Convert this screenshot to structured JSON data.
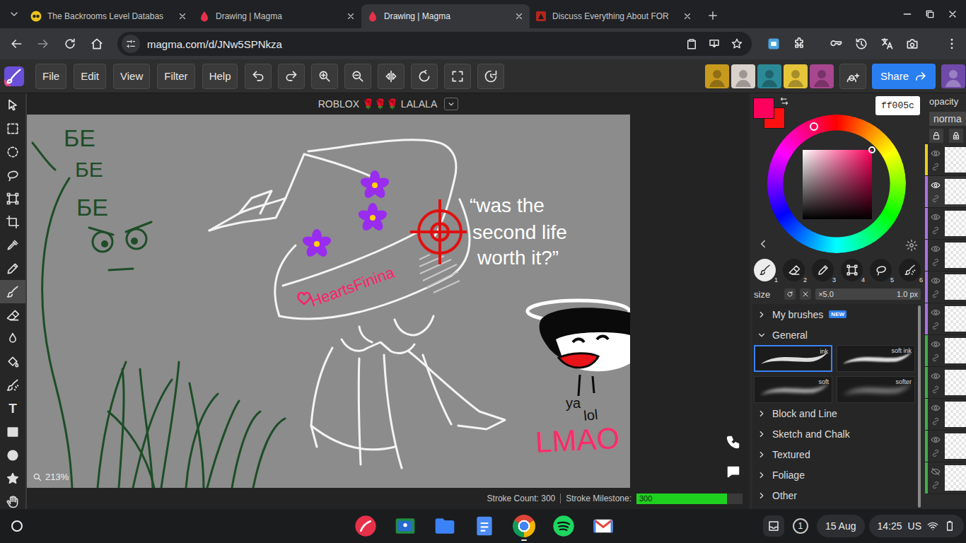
{
  "browser": {
    "tabs": [
      {
        "title": "The Backrooms Level Databas",
        "kind": "wiki",
        "selected": false
      },
      {
        "title": "Drawing | Magma",
        "kind": "magma",
        "selected": false
      },
      {
        "title": "Drawing | Magma",
        "kind": "magma",
        "selected": true
      },
      {
        "title": "Discuss Everything About FOR",
        "kind": "forum",
        "selected": false
      }
    ],
    "url": "magma.com/d/JNw5SPNkza"
  },
  "menu": [
    {
      "label": "File"
    },
    {
      "label": "Edit"
    },
    {
      "label": "View"
    },
    {
      "label": "Filter"
    },
    {
      "label": "Help"
    }
  ],
  "collaborators": [
    {
      "color": "#c79a1e"
    },
    {
      "color": "#d9d2cb"
    },
    {
      "color": "#2c8a96"
    },
    {
      "color": "#e6c53a"
    },
    {
      "color": "#a8478f"
    }
  ],
  "share": {
    "label": "Share"
  },
  "profile": {
    "color": "#6f4aa8"
  },
  "document": {
    "title": "ROBLOX 🌹🌹🌹 LALALA"
  },
  "tools": [
    {
      "kind": "move",
      "selected": false
    },
    {
      "kind": "marquee",
      "selected": false
    },
    {
      "kind": "oval",
      "selected": false
    },
    {
      "kind": "lasso",
      "selected": false
    },
    {
      "kind": "transform",
      "selected": false
    },
    {
      "kind": "crop",
      "selected": false
    },
    {
      "kind": "eyedropper",
      "selected": false
    },
    {
      "kind": "pencil",
      "selected": false
    },
    {
      "kind": "brush",
      "selected": true
    },
    {
      "kind": "eraser",
      "selected": false
    },
    {
      "kind": "smudge",
      "selected": false
    },
    {
      "kind": "fill",
      "selected": false
    },
    {
      "kind": "blend",
      "selected": false
    },
    {
      "kind": "text",
      "glyph": "T",
      "selected": false
    },
    {
      "kind": "rectangle",
      "selected": false
    },
    {
      "kind": "circle",
      "selected": false
    },
    {
      "kind": "shape",
      "selected": false
    },
    {
      "kind": "hand",
      "selected": false
    }
  ],
  "canvas": {
    "zoom": "213%",
    "texts": [
      {
        "text": "БЕ",
        "color": "#1d4d27"
      },
      {
        "text": "БЕ",
        "color": "#1d4d27"
      },
      {
        "text": "БЕ",
        "color": "#1d4d27"
      },
      {
        "text": "“was the",
        "color": "#ffffff"
      },
      {
        "text": "second life",
        "color": "#ffffff"
      },
      {
        "text": "worth it?”",
        "color": "#ffffff"
      },
      {
        "text": "HeartsFinina",
        "color": "#ff1f6b"
      },
      {
        "text": "ya",
        "color": "#111111"
      },
      {
        "text": "lol",
        "color": "#111111"
      },
      {
        "text": "LMAO",
        "color": "#ff2a6a"
      }
    ]
  },
  "status": {
    "stroke_count": "Stroke Count: 300",
    "milestone_label": "Stroke Milestone:",
    "milestone": "300",
    "level": 0.85
  },
  "color": {
    "hex": "ff005c",
    "primary": "#ff005c",
    "secondary": "#ff1010"
  },
  "brush_slots": [
    {
      "number": "1",
      "kind": "brush",
      "selected": true
    },
    {
      "number": "2",
      "kind": "eraser",
      "selected": false
    },
    {
      "number": "3",
      "kind": "pencil",
      "selected": false
    },
    {
      "number": "4",
      "kind": "transform",
      "selected": false
    },
    {
      "number": "5",
      "kind": "lasso",
      "selected": false
    },
    {
      "number": "6",
      "kind": "blend",
      "selected": false
    }
  ],
  "size": {
    "label": "size",
    "multiplier": "×5.0",
    "value": "1.0 px"
  },
  "brush_groups": [
    {
      "label": "My brushes",
      "badge": "NEW",
      "expanded": false,
      "presets": []
    },
    {
      "label": "General",
      "expanded": true,
      "presets": [
        {
          "name": "ink",
          "kind": "ink",
          "selected": true
        },
        {
          "name": "soft ink",
          "kind": "inksoft",
          "selected": false
        },
        {
          "name": "soft",
          "kind": "soft",
          "selected": false
        },
        {
          "name": "softer",
          "kind": "softer",
          "selected": false
        }
      ]
    },
    {
      "label": "Block and Line",
      "expanded": false,
      "presets": []
    },
    {
      "label": "Sketch and Chalk",
      "expanded": false,
      "presets": []
    },
    {
      "label": "Textured",
      "expanded": false,
      "presets": []
    },
    {
      "label": "Foliage",
      "expanded": false,
      "presets": []
    },
    {
      "label": "Other",
      "expanded": false,
      "presets": []
    }
  ],
  "layers": {
    "opacity_label": "opacity",
    "blend": "norma",
    "items": [
      {
        "color": "#e8cf1c",
        "visible": true,
        "selected": false
      },
      {
        "color": "#a873e6",
        "visible": true,
        "selected": true
      },
      {
        "color": "#a873e6",
        "visible": true,
        "selected": false
      },
      {
        "color": "#a873e6",
        "visible": true,
        "selected": false
      },
      {
        "color": "#a873e6",
        "visible": true,
        "selected": false
      },
      {
        "color": "#a873e6",
        "visible": true,
        "selected": false
      },
      {
        "color": "#3fae4a",
        "visible": true,
        "selected": false
      },
      {
        "color": "#3fae4a",
        "visible": true,
        "selected": false
      },
      {
        "color": "#3fae4a",
        "visible": true,
        "selected": false
      },
      {
        "color": "#3fae4a",
        "visible": true,
        "selected": false
      },
      {
        "color": "#3fae4a",
        "visible": false,
        "selected": false
      }
    ]
  },
  "shelf": {
    "apps": [
      {
        "kind": "magma",
        "active": false
      },
      {
        "kind": "classroom",
        "active": false
      },
      {
        "kind": "files",
        "active": false
      },
      {
        "kind": "docs",
        "active": false
      },
      {
        "kind": "chrome",
        "active": true
      },
      {
        "kind": "spotify",
        "active": false
      },
      {
        "kind": "gmail",
        "active": false
      }
    ],
    "notifications": "1",
    "date": "15 Aug",
    "time": "14:25",
    "region": "US"
  }
}
